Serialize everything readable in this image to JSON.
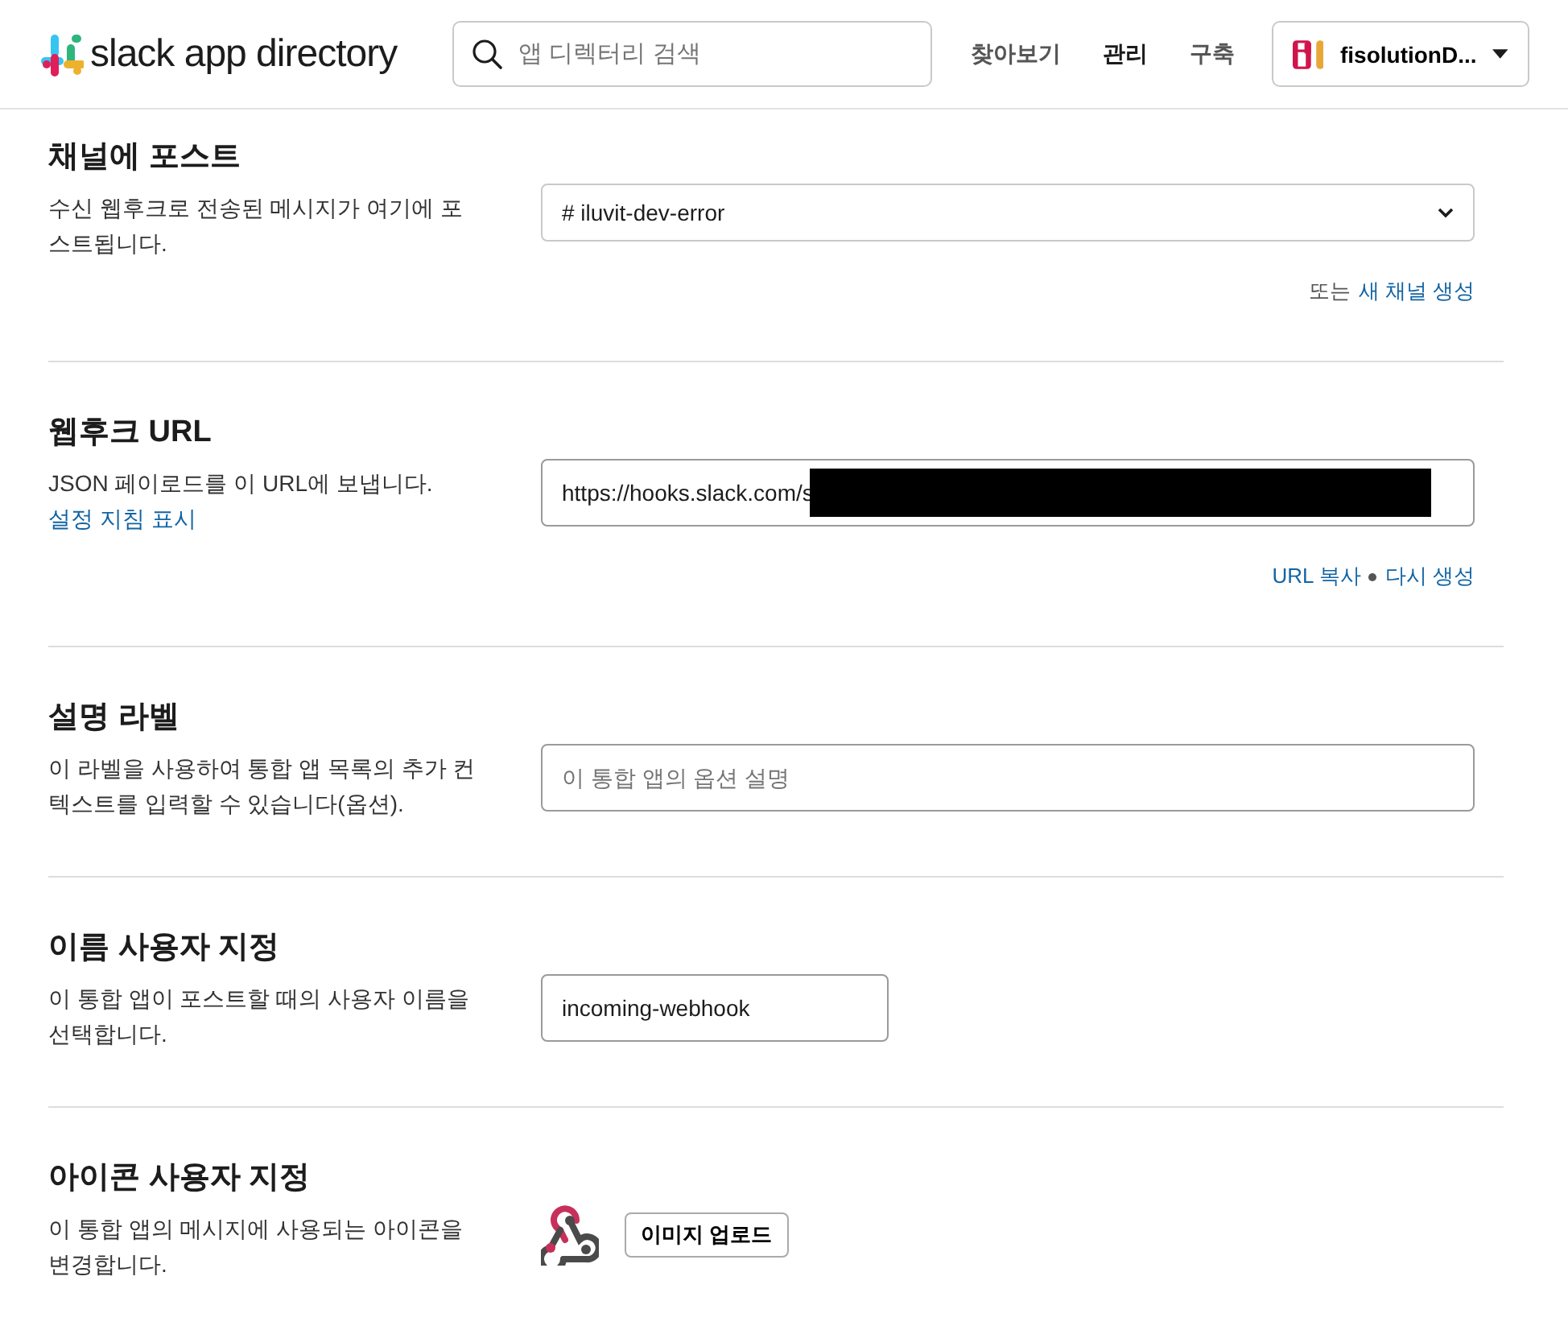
{
  "header": {
    "logo_text": "slack app directory",
    "search": {
      "placeholder": "앱 디렉터리 검색"
    },
    "nav": [
      {
        "label": "찾아보기",
        "selected": false
      },
      {
        "label": "관리",
        "selected": true
      },
      {
        "label": "구축",
        "selected": false
      }
    ],
    "workspace": {
      "label": "fisolutionD..."
    }
  },
  "sections": [
    {
      "kind": "select",
      "title": "채널에 포스트",
      "description": "수신 웹후크로 전송된 메시지가 여기에 포스트됩니다.",
      "value": "# iluvit-dev-error",
      "note": "또는",
      "links": [
        "새 채널 생성"
      ]
    },
    {
      "kind": "url",
      "title": "웹후크 URL",
      "description": "JSON 페이로드를 이 URL에 보냅니다.",
      "desc_link": "설정 지침 표시",
      "value": "https://hooks.slack.com/s",
      "redacted": true,
      "links": [
        "URL 복사",
        "다시 생성"
      ]
    },
    {
      "kind": "input",
      "title": "설명 라벨",
      "description": "이 라벨을 사용하여 통합 앱 목록의 추가 컨텍스트를 입력할 수 있습니다(옵션).",
      "placeholder": "이 통합 앱의 옵션 설명"
    },
    {
      "kind": "short",
      "title": "이름 사용자 지정",
      "description": "이 통합 앱이 포스트할 때의 사용자 이름을 선택합니다.",
      "value": "incoming-webhook"
    },
    {
      "kind": "icon",
      "title": "아이콘 사용자 지정",
      "description": "이 통합 앱의 메시지에 사용되는 아이콘을 변경합니다.",
      "button": "이미지 업로드"
    }
  ]
}
